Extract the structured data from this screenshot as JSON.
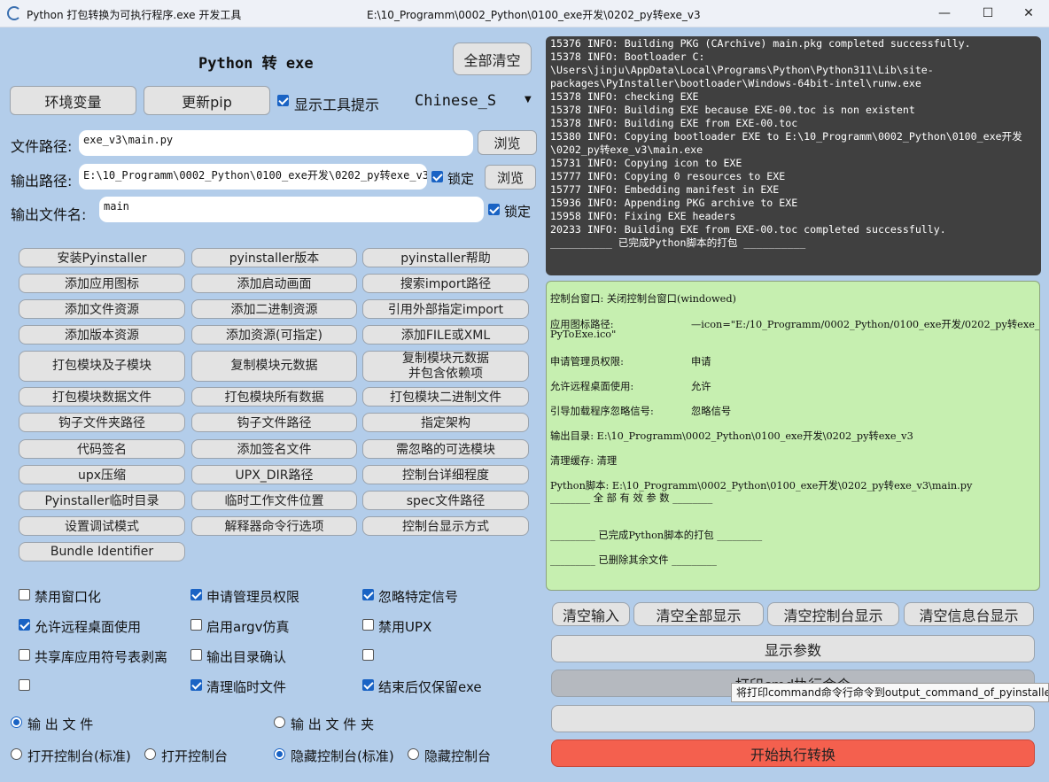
{
  "window": {
    "title": "Python 打包转换为可执行程序.exe 开发工具",
    "path": "E:\\10_Programm\\0002_Python\\0100_exe开发\\0202_py转exe_v3",
    "min": "—",
    "max": "☐",
    "close": "✕"
  },
  "header": {
    "title": "Python 转 exe",
    "clear_all": "全部清空",
    "env_vars": "环境变量",
    "update_pip": "更新pip",
    "show_tooltip": "显示工具提示",
    "language": "Chinese_S"
  },
  "paths": {
    "file_label": "文件路径:",
    "file_value": "exe_v3\\main.py",
    "browse": "浏览",
    "output_label": "输出路径:",
    "output_value": "E:\\10_Programm\\0002_Python\\0100_exe开发\\0202_py转exe_v3",
    "lock": "锁定",
    "output_name_label": "输出文件名:",
    "output_name_value": "main"
  },
  "option_buttons": [
    "安装Pyinstaller",
    "pyinstaller版本",
    "pyinstaller帮助",
    "添加应用图标",
    "添加启动画面",
    "搜索import路径",
    "添加文件资源",
    "添加二进制资源",
    "引用外部指定import",
    "添加版本资源",
    "添加资源(可指定)",
    "添加FILE或XML",
    "打包模块及子模块",
    "复制模块元数据",
    "复制模块元数据\n并包含依赖项",
    "打包模块数据文件",
    "打包模块所有数据",
    "打包模块二进制文件",
    "钩子文件夹路径",
    "钩子文件路径",
    "指定架构",
    "代码签名",
    "添加签名文件",
    "需忽略的可选模块",
    "upx压缩",
    "UPX_DIR路径",
    "控制台详细程度",
    "Pyinstaller临时目录",
    "临时工作文件位置",
    "spec文件路径",
    "设置调试模式",
    "解释器命令行选项",
    "控制台显示方式",
    "Bundle Identifier"
  ],
  "checkboxes": [
    {
      "label": "禁用窗口化",
      "checked": false
    },
    {
      "label": "申请管理员权限",
      "checked": true
    },
    {
      "label": "忽略特定信号",
      "checked": true
    },
    {
      "label": "允许远程桌面使用",
      "checked": true
    },
    {
      "label": "启用argv仿真",
      "checked": false
    },
    {
      "label": "禁用UPX",
      "checked": false
    },
    {
      "label": "共享库应用符号表剥离",
      "checked": false
    },
    {
      "label": "输出目录确认",
      "checked": false
    },
    {
      "label": "",
      "checked": false
    },
    {
      "label": "",
      "checked": false
    },
    {
      "label": "清理临时文件",
      "checked": true
    },
    {
      "label": "结束后仅保留exe",
      "checked": true
    }
  ],
  "radios": {
    "output_file": "输 出 文 件",
    "output_folder": "输 出 文 件 夹",
    "open_console_std": "打开控制台(标准)",
    "open_console": "打开控制台",
    "hide_console_std": "隐藏控制台(标准)",
    "hide_console": "隐藏控制台"
  },
  "console_lines": [
    "15376 INFO: Building PKG (CArchive) main.pkg completed successfully.",
    "15378 INFO: Bootloader C:",
    "\\Users\\jinju\\AppData\\Local\\Programs\\Python\\Python311\\Lib\\site-",
    "packages\\PyInstaller\\bootloader\\Windows-64bit-intel\\runw.exe",
    "15378 INFO: checking EXE",
    "15378 INFO: Building EXE because EXE-00.toc is non existent",
    "15378 INFO: Building EXE from EXE-00.toc",
    "15380 INFO: Copying bootloader EXE to E:\\10_Programm\\0002_Python\\0100_exe开发",
    "\\0202_py转exe_v3\\main.exe",
    "15731 INFO: Copying icon to EXE",
    "15777 INFO: Copying 0 resources to EXE",
    "15777 INFO: Embedding manifest in EXE",
    "15936 INFO: Appending PKG archive to EXE",
    "15958 INFO: Fixing EXE headers",
    "20233 INFO: Building EXE from EXE-00.toc completed successfully.",
    "__________ 已完成Python脚本的打包 __________"
  ],
  "info": {
    "console_window": "控制台窗口:  关闭控制台窗口(windowed)",
    "icon_label": "应用图标路径:",
    "icon_value": "—icon=\"E:/10_Programm/0002_Python/0100_exe开发/0202_py转exe_v3/",
    "icon_value2": "PyToExe.ico\"",
    "admin_label": "申请管理员权限:",
    "admin_value": "申请",
    "remote_label": "允许远程桌面使用:",
    "remote_value": "允许",
    "signal_label": "引导加载程序忽略信号:",
    "signal_value": "忽略信号",
    "outdir": "输出目录:   E:\\10_Programm\\0002_Python\\0100_exe开发\\0202_py转exe_v3",
    "clean": "清理缓存:   清理",
    "script": "Python脚本:  E:\\10_Programm\\0002_Python\\0100_exe开发\\0202_py转exe_v3\\main.py",
    "all_params": "________  全 部 有 效 参 数  ________",
    "done": "_________ 已完成Python脚本的打包 _________",
    "deleted": "_________ 已删除其余文件 _________"
  },
  "actions": {
    "clear_input": "清空输入",
    "clear_all_display": "清空全部显示",
    "clear_console_display": "清空控制台显示",
    "clear_info_display": "清空信息台显示",
    "show_params": "显示参数",
    "print_cmd": "打印cmd执行命令",
    "start": "开始执行转换",
    "tooltip": "将打印command命令行命令到output_command_of_pyinstaller.txt"
  },
  "colors": {
    "start_button": "#f4604e",
    "console_bg": "#404040",
    "info_bg": "#c6efb0",
    "window_bg": "#b3cdea"
  }
}
